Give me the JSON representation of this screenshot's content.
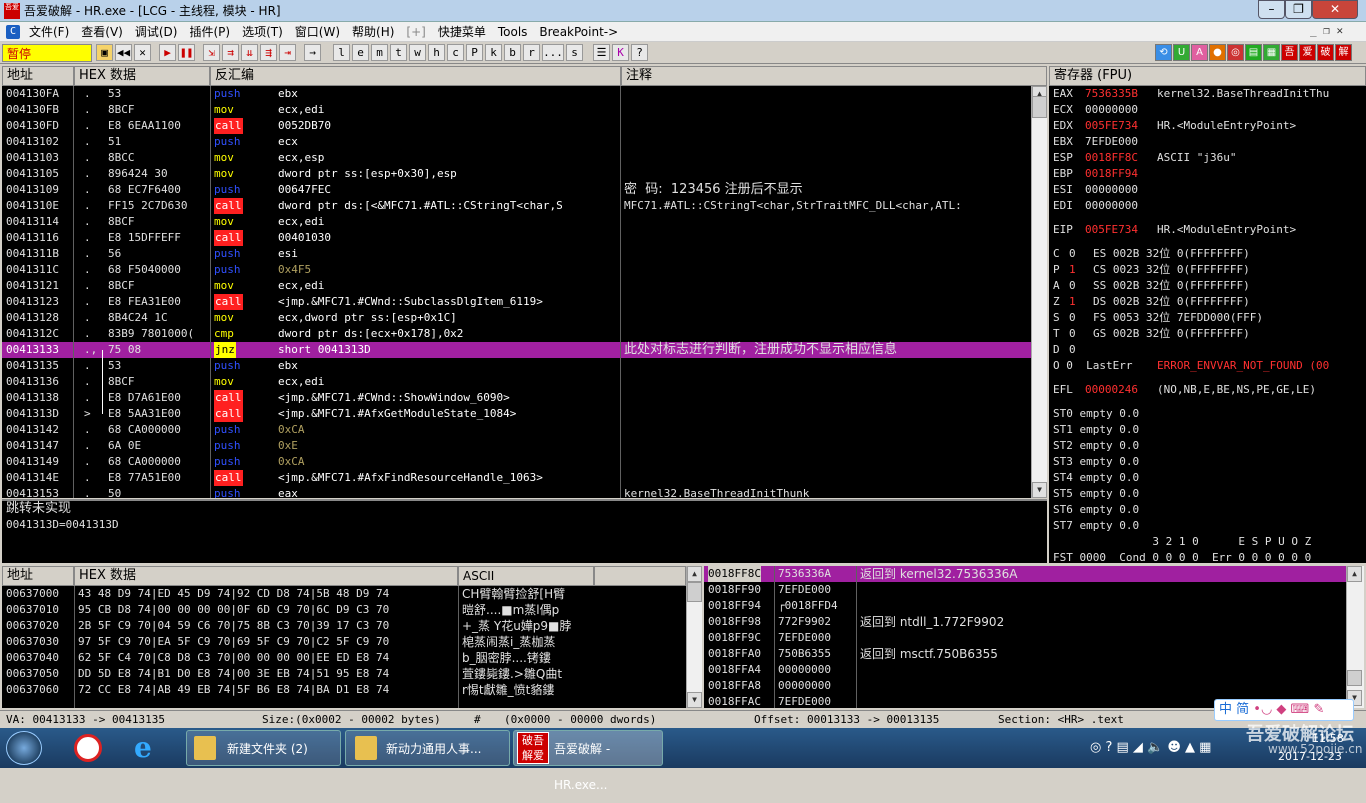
{
  "window": {
    "title": "吾爱破解 - HR.exe - [LCG - 主线程, 模块 - HR]"
  },
  "menu": [
    {
      "label": "文件(F)"
    },
    {
      "label": "查看(V)"
    },
    {
      "label": "调试(D)"
    },
    {
      "label": "插件(P)"
    },
    {
      "label": "选项(T)"
    },
    {
      "label": "窗口(W)"
    },
    {
      "label": "帮助(H)"
    },
    {
      "label": "[+]"
    },
    {
      "label": "快捷菜单"
    },
    {
      "label": "Tools"
    },
    {
      "label": "BreakPoint->"
    }
  ],
  "toolbar": {
    "status": "暂停",
    "letters": [
      "l",
      "e",
      "m",
      "t",
      "w",
      "h",
      "c",
      "P",
      "k",
      "b",
      "r",
      "...",
      "s"
    ],
    "plugin_buttons": [
      "吾",
      "爱",
      "破",
      "解"
    ]
  },
  "cpu": {
    "headers": {
      "addr": "地址",
      "hex": "HEX 数据",
      "disasm": "反汇编",
      "comment": "注释"
    },
    "rows": [
      {
        "addr": "004130FA",
        "mark": ".",
        "hex": "53",
        "mn": "push",
        "mnc": "push",
        "ops": "ebx",
        "comment": ""
      },
      {
        "addr": "004130FB",
        "mark": ".",
        "hex": "8BCF",
        "mn": "mov",
        "mnc": "mov",
        "ops": "ecx,edi",
        "comment": ""
      },
      {
        "addr": "004130FD",
        "mark": ".",
        "hex": "E8 6EAA1100",
        "mn": "call",
        "mnc": "call",
        "ops": "0052DB70",
        "comment": ""
      },
      {
        "addr": "00413102",
        "mark": ".",
        "hex": "51",
        "mn": "push",
        "mnc": "push",
        "ops": "ecx",
        "comment": ""
      },
      {
        "addr": "00413103",
        "mark": ".",
        "hex": "8BCC",
        "mn": "mov",
        "mnc": "mov",
        "ops": "ecx,esp",
        "comment": ""
      },
      {
        "addr": "00413105",
        "mark": ".",
        "hex": "896424 30",
        "mn": "mov",
        "mnc": "mov",
        "ops": "dword ptr ss:[esp+0x30],esp",
        "comment": ""
      },
      {
        "addr": "00413109",
        "mark": ".",
        "hex": "68 EC7F6400",
        "mn": "push",
        "mnc": "push",
        "ops": "00647FEC",
        "comment": "密  码:  123456 注册后不显示"
      },
      {
        "addr": "0041310E",
        "mark": ".",
        "hex": "FF15 2C7D630",
        "mn": "call",
        "mnc": "call",
        "ops": "dword ptr ds:[<&MFC71.#ATL::CStringT<char,S",
        "comment": "MFC71.#ATL::CStringT<char,StrTraitMFC_DLL<char,ATL:"
      },
      {
        "addr": "00413114",
        "mark": ".",
        "hex": "8BCF",
        "mn": "mov",
        "mnc": "mov",
        "ops": "ecx,edi",
        "comment": ""
      },
      {
        "addr": "00413116",
        "mark": ".",
        "hex": "E8 15DFFEFF",
        "mn": "call",
        "mnc": "call",
        "ops": "00401030",
        "comment": ""
      },
      {
        "addr": "0041311B",
        "mark": ".",
        "hex": "56",
        "mn": "push",
        "mnc": "push",
        "ops": "esi",
        "comment": ""
      },
      {
        "addr": "0041311C",
        "mark": ".",
        "hex": "68 F5040000",
        "mn": "push",
        "mnc": "push",
        "ops": "0x4F5",
        "comment": ""
      },
      {
        "addr": "00413121",
        "mark": ".",
        "hex": "8BCF",
        "mn": "mov",
        "mnc": "mov",
        "ops": "ecx,edi",
        "comment": ""
      },
      {
        "addr": "00413123",
        "mark": ".",
        "hex": "E8 FEA31E00",
        "mn": "call",
        "mnc": "call",
        "ops": "<jmp.&MFC71.#CWnd::SubclassDlgItem_6119>",
        "comment": ""
      },
      {
        "addr": "00413128",
        "mark": ".",
        "hex": "8B4C24 1C",
        "mn": "mov",
        "mnc": "mov",
        "ops": "ecx,dword ptr ss:[esp+0x1C]",
        "comment": ""
      },
      {
        "addr": "0041312C",
        "mark": ".",
        "hex": "83B9 7801000(",
        "mn": "cmp",
        "mnc": "cmp",
        "ops": "dword ptr ds:[ecx+0x178],0x2",
        "comment": ""
      },
      {
        "addr": "00413133",
        "mark": ".,",
        "hex": "75 08",
        "mn": "jnz",
        "mnc": "jnz",
        "ops": "short 0041313D",
        "comment": "此处对标志进行判断，注册成功不显示相应信息",
        "selected": true
      },
      {
        "addr": "00413135",
        "mark": ".",
        "hex": "53",
        "mn": "push",
        "mnc": "push",
        "ops": "ebx",
        "comment": ""
      },
      {
        "addr": "00413136",
        "mark": ".",
        "hex": "8BCF",
        "mn": "mov",
        "mnc": "mov",
        "ops": "ecx,edi",
        "comment": ""
      },
      {
        "addr": "00413138",
        "mark": ".",
        "hex": "E8 D7A61E00",
        "mn": "call",
        "mnc": "call",
        "ops": "<jmp.&MFC71.#CWnd::ShowWindow_6090>",
        "comment": ""
      },
      {
        "addr": "0041313D",
        "mark": ">",
        "hex": "E8 5AA31E00",
        "mn": "call",
        "mnc": "call",
        "ops": "<jmp.&MFC71.#AfxGetModuleState_1084>",
        "comment": ""
      },
      {
        "addr": "00413142",
        "mark": ".",
        "hex": "68 CA000000",
        "mn": "push",
        "mnc": "push",
        "ops": "0xCA",
        "comment": ""
      },
      {
        "addr": "00413147",
        "mark": ".",
        "hex": "6A 0E",
        "mn": "push",
        "mnc": "push",
        "ops": "0xE",
        "comment": ""
      },
      {
        "addr": "00413149",
        "mark": ".",
        "hex": "68 CA000000",
        "mn": "push",
        "mnc": "push",
        "ops": "0xCA",
        "comment": ""
      },
      {
        "addr": "0041314E",
        "mark": ".",
        "hex": "E8 77A51E00",
        "mn": "call",
        "mnc": "call",
        "ops": "<jmp.&MFC71.#AfxFindResourceHandle_1063>",
        "comment": ""
      },
      {
        "addr": "00413153",
        "mark": ".",
        "hex": "50",
        "mn": "push",
        "mnc": "push",
        "ops": "eax",
        "comment": "kernel32.BaseThreadInitThunk"
      }
    ],
    "info": [
      "跳转未实现",
      "0041313D=0041313D"
    ]
  },
  "registers": {
    "header": "寄存器 (FPU)",
    "gp": [
      {
        "name": "EAX",
        "val": "7536335B",
        "red": true,
        "note": "kernel32.BaseThreadInitThu"
      },
      {
        "name": "ECX",
        "val": "00000000",
        "red": false,
        "note": ""
      },
      {
        "name": "EDX",
        "val": "005FE734",
        "red": true,
        "note": "HR.<ModuleEntryPoint>"
      },
      {
        "name": "EBX",
        "val": "7EFDE000",
        "red": false,
        "note": ""
      },
      {
        "name": "ESP",
        "val": "0018FF8C",
        "red": true,
        "note": "ASCII \"j36u\""
      },
      {
        "name": "EBP",
        "val": "0018FF94",
        "red": true,
        "note": ""
      },
      {
        "name": "ESI",
        "val": "00000000",
        "red": false,
        "note": ""
      },
      {
        "name": "EDI",
        "val": "00000000",
        "red": false,
        "note": ""
      }
    ],
    "eip": {
      "name": "EIP",
      "val": "005FE734",
      "note": "HR.<ModuleEntryPoint>"
    },
    "flags": [
      {
        "f": "C",
        "v": "0",
        "red": false,
        "seg": "ES 002B 32位 0(FFFFFFFF)"
      },
      {
        "f": "P",
        "v": "1",
        "red": true,
        "seg": "CS 0023 32位 0(FFFFFFFF)"
      },
      {
        "f": "A",
        "v": "0",
        "red": false,
        "seg": "SS 002B 32位 0(FFFFFFFF)"
      },
      {
        "f": "Z",
        "v": "1",
        "red": true,
        "seg": "DS 002B 32位 0(FFFFFFFF)"
      },
      {
        "f": "S",
        "v": "0",
        "red": false,
        "seg": "FS 0053 32位 7EFDD000(FFF)"
      },
      {
        "f": "T",
        "v": "0",
        "red": false,
        "seg": "GS 002B 32位 0(FFFFFFFF)"
      },
      {
        "f": "D",
        "v": "0",
        "red": false,
        "seg": ""
      }
    ],
    "lasterr": {
      "prefix": "O 0  LastErr",
      "val": "ERROR_ENVVAR_NOT_FOUND (00"
    },
    "efl": {
      "name": "EFL",
      "val": "00000246",
      "note": "(NO,NB,E,BE,NS,PE,GE,LE)"
    },
    "st": [
      "ST0 empty 0.0",
      "ST1 empty 0.0",
      "ST2 empty 0.0",
      "ST3 empty 0.0",
      "ST4 empty 0.0",
      "ST5 empty 0.0",
      "ST6 empty 0.0",
      "ST7 empty 0.0"
    ],
    "fpu1": "               3 2 1 0      E S P U O Z",
    "fpu2": "FST 0000  Cond 0 0 0 0  Err 0 0 0 0 0 0"
  },
  "dump": {
    "headers": {
      "addr": "地址",
      "hex": "HEX 数据",
      "ascii": "ASCII"
    },
    "rows": [
      {
        "addr": "00637000",
        "hex": "43 48 D9 74|ED 45 D9 74|92 CD D8 74|5B 48 D9 74",
        "ascii": "CH臂翰臂捡舒[H臂"
      },
      {
        "addr": "00637010",
        "hex": "95 CB D8 74|00 00 00 00|0F 6D C9 70|6C D9 C3 70",
        "ascii": "暟舒....■m蒸l偶p"
      },
      {
        "addr": "00637020",
        "hex": "2B 5F C9 70|04 59 C6 70|75 8B C3 70|39 17 C3 70",
        "ascii": "+_蒸 Y花u嬅p9■脖"
      },
      {
        "addr": "00637030",
        "hex": "97 5F C9 70|EA 5F C9 70|69 5F C9 70|C2 5F C9 70",
        "ascii": "梍蒸闹蒸i_蒸枷蒸"
      },
      {
        "addr": "00637040",
        "hex": "62 5F C4 70|C8 D8 C3 70|00 00 00 00|EE ED E8 74",
        "ascii": "b_胭密脖....铐鏤"
      },
      {
        "addr": "00637050",
        "hex": "DD 5D E8 74|B1 D0 E8 74|00 3E EB 74|51 95 E8 74",
        "ascii": "萓鏤毙鏤.>雛Q曲t"
      },
      {
        "addr": "00637060",
        "hex": "72 CC E8 74|AB 49 EB 74|5F B6 E8 74|BA D1 E8 74",
        "ascii": "r惕t獻雛_愤t貉鏤"
      }
    ]
  },
  "stack": {
    "rows": [
      {
        "addr": "0018FF8C",
        "val": "7536336A",
        "note": "返回到 kernel32.7536336A",
        "selected": true
      },
      {
        "addr": "0018FF90",
        "val": "7EFDE000",
        "note": ""
      },
      {
        "addr": "0018FF94",
        "val": "┌0018FFD4",
        "note": ""
      },
      {
        "addr": "0018FF98",
        "val": "772F9902",
        "note": "返回到 ntdll_1.772F9902"
      },
      {
        "addr": "0018FF9C",
        "val": "7EFDE000",
        "note": ""
      },
      {
        "addr": "0018FFA0",
        "val": "750B6355",
        "note": "返回到 msctf.750B6355"
      },
      {
        "addr": "0018FFA4",
        "val": "00000000",
        "note": ""
      },
      {
        "addr": "0018FFA8",
        "val": "00000000",
        "note": ""
      },
      {
        "addr": "0018FFAC",
        "val": "7EFDE000",
        "note": ""
      }
    ]
  },
  "statusbar": {
    "va": "VA: 00413133 -> 00413135",
    "size": "Size:(0x0002 - 00002 bytes)",
    "hash": "#",
    "dwords": "(0x0000 - 00000 dwords)",
    "offset": "Offset: 00013133 -> 00013135",
    "section": "Section: <HR> .text"
  },
  "taskbar": {
    "tasks": [
      "新建文件夹 (2)",
      "新动力通用人事...",
      "吾爱破解 - HR.exe..."
    ],
    "ime": "中 简",
    "clock": "11:58",
    "date": "2017-12-23",
    "watermark": "吾爱破解论坛",
    "watermark_url": "www.52pojie.cn"
  }
}
